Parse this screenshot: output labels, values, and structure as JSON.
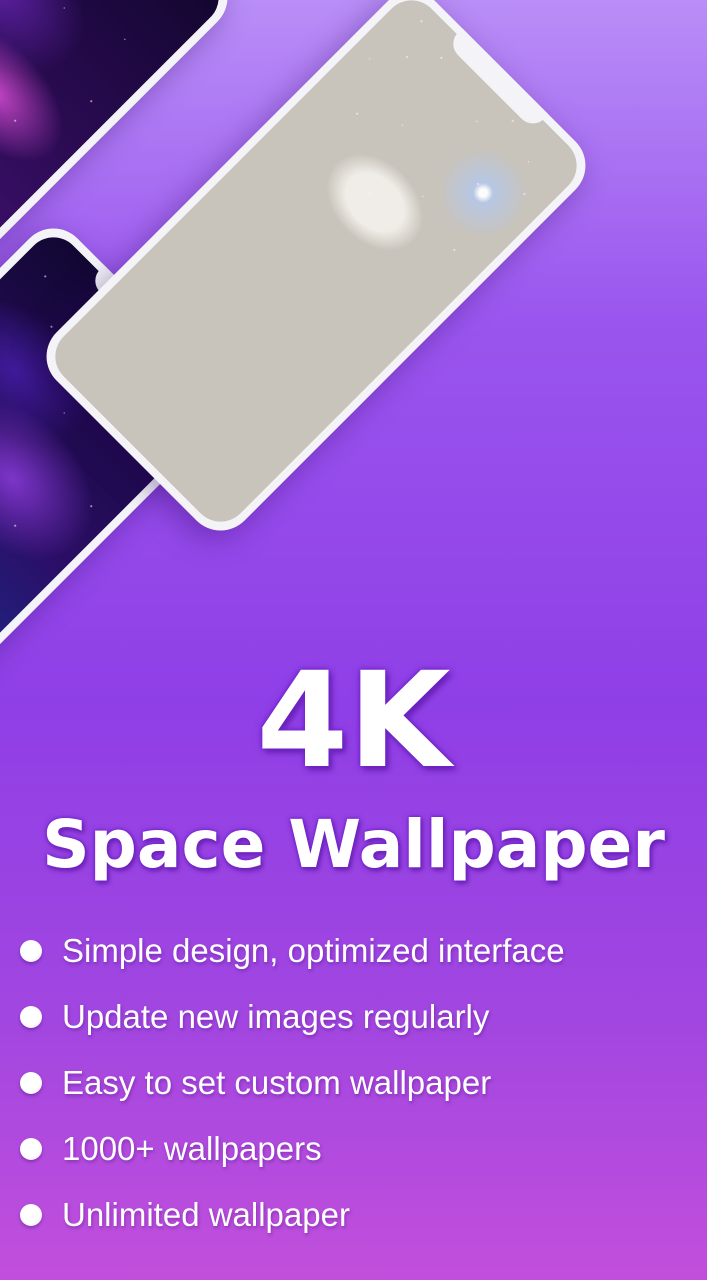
{
  "hero": {
    "title": "4K",
    "subtitle": "Space Wallpaper"
  },
  "features": [
    "Simple design, optimized interface",
    "Update new images regularly",
    "Easy to set custom wallpaper",
    "1000+ wallpapers",
    "Unlimited wallpaper"
  ],
  "colors": {
    "background_top": "#b98ef7",
    "background_mid": "#8f3fe6",
    "background_bottom": "#c24fdc",
    "text": "#ffffff",
    "phone_frame": "#f4f4f8"
  },
  "icons": {
    "feature_bullet": "bullet-dot-icon"
  }
}
